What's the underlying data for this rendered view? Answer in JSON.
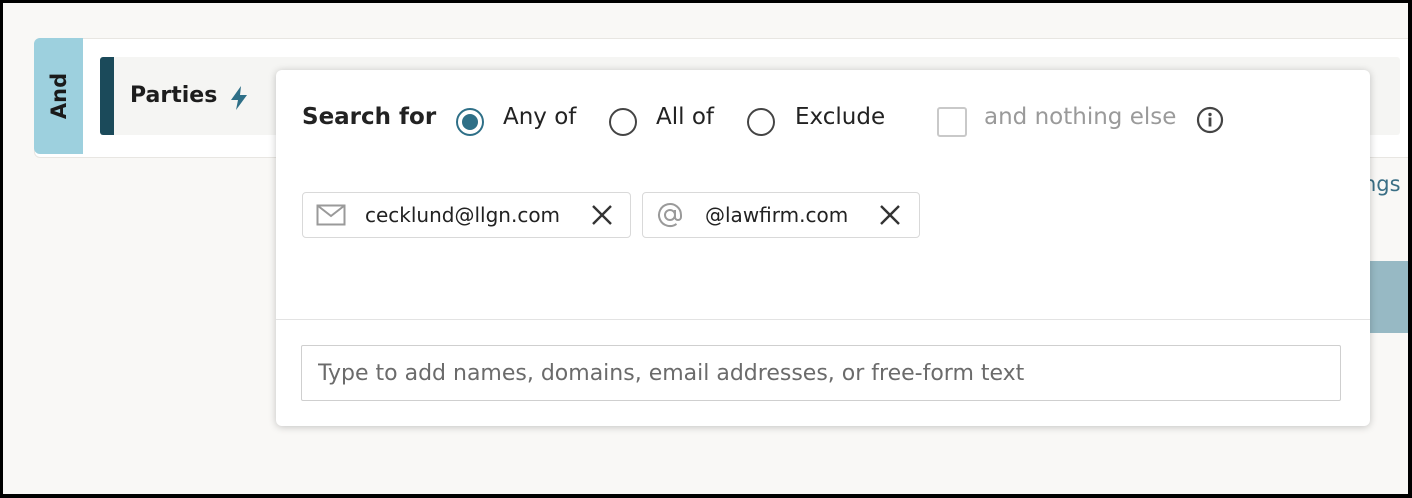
{
  "group": {
    "operator_label": "And"
  },
  "filter": {
    "title": "Parties",
    "icon": "lightning-bolt-icon",
    "partial_link_text": "ngs"
  },
  "popover": {
    "search_for_label": "Search for",
    "modes": [
      {
        "label": "Any of",
        "selected": true
      },
      {
        "label": "All of",
        "selected": false
      },
      {
        "label": "Exclude",
        "selected": false
      }
    ],
    "nothing_else": {
      "label": "and nothing else",
      "checked": false,
      "enabled": false,
      "info_icon": "info-icon"
    },
    "chips": [
      {
        "icon": "envelope-icon",
        "text": "cecklund@llgn.com"
      },
      {
        "icon": "at-sign-icon",
        "text": "@lawfirm.com"
      }
    ],
    "input": {
      "value": "",
      "placeholder": "Type to add names, domains, email addresses, or free-form text"
    }
  },
  "colors": {
    "and_tab": "#9dd0de",
    "filter_bar": "#1b4a5a",
    "accent": "#2e6f87",
    "link": "#3a6f85"
  }
}
